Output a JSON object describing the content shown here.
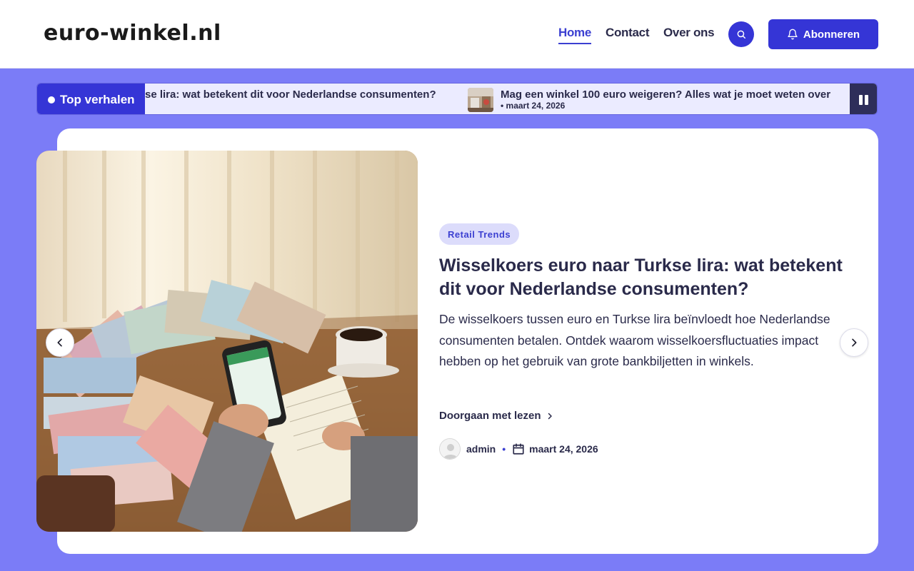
{
  "header": {
    "logo": "euro-winkel.nl",
    "nav": [
      {
        "label": "Home"
      },
      {
        "label": "Contact"
      },
      {
        "label": "Over ons"
      }
    ],
    "subscribe_label": "Abonneren"
  },
  "ticker": {
    "label": "Top verhalen",
    "items": [
      {
        "title": "se lira: wat betekent dit voor Nederlandse consumenten?"
      },
      {
        "title": "Mag een winkel 100 euro weigeren? Alles wat je moet weten over",
        "date": "• maart 24, 2026"
      }
    ]
  },
  "slide": {
    "category": "Retail Trends",
    "title": "Wisselkoers euro naar Turkse lira: wat betekent dit voor Nederlandse consumenten?",
    "excerpt": "De wisselkoers tussen euro en Turkse lira beïnvloedt hoe Nederlandse consumenten betalen. Ontdek waarom wisselkoersfluctuaties impact hebben op het gebruik van grote bankbiljetten in winkels.",
    "read_more": "Doorgaan met lezen",
    "author": "admin",
    "date": "maart 24, 2026"
  },
  "colors": {
    "accent": "#3535d6",
    "background": "#7b7cf7",
    "text": "#2a2a4a"
  },
  "icons": [
    "search-icon",
    "bell-icon",
    "pause-icon",
    "chevron-left-icon",
    "chevron-right-icon",
    "chevron-right-small-icon",
    "calendar-icon",
    "avatar"
  ]
}
